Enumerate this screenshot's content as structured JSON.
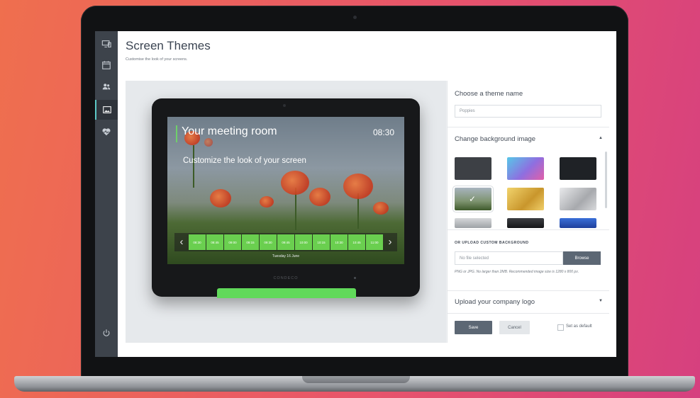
{
  "page": {
    "title": "Screen Themes",
    "subtitle": "Customise the look of your screens."
  },
  "sidebar": {
    "items": [
      {
        "icon": "monitor-icon",
        "active": false
      },
      {
        "icon": "calendar-icon",
        "active": false
      },
      {
        "icon": "users-icon",
        "active": false
      },
      {
        "icon": "image-icon",
        "active": true
      },
      {
        "icon": "heart-pulse-icon",
        "active": false
      }
    ],
    "bottom_icon": "power-icon"
  },
  "preview": {
    "room_name": "Your meeting room",
    "time": "08:30",
    "message": "Customize the look of your screen",
    "slots": [
      "08:30",
      "08:45",
      "09:00",
      "09:15",
      "09:30",
      "09:45",
      "10:00",
      "10:15",
      "10:30",
      "10:45",
      "11:00"
    ],
    "date": "Tuesday 16 June",
    "brand": "CONDECO",
    "accent_color": "#6acf4f"
  },
  "panel": {
    "theme_name_title": "Choose a theme name",
    "theme_name_value": "Poppies",
    "background_title": "Change background image",
    "upload_title": "OR UPLOAD CUSTOM BACKGROUND",
    "file_placeholder": "No file selected",
    "browse_label": "Browse",
    "hint": "PNG or JPG. No larger than 2MB. Recommended image size is 1280 x 800 px.",
    "logo_title": "Upload your company logo",
    "save_label": "Save",
    "cancel_label": "Cancel",
    "default_label": "Set as default"
  }
}
